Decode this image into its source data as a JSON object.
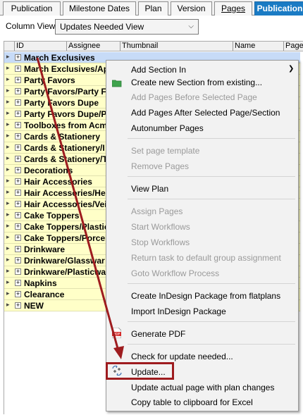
{
  "tabs": [
    {
      "label": "Publication",
      "active": false
    },
    {
      "label": "Milestone Dates",
      "active": false
    },
    {
      "label": "Plan",
      "active": false
    },
    {
      "label": "Version",
      "active": false
    },
    {
      "label": "Pages",
      "active": false
    },
    {
      "label": "Publication",
      "active": true
    }
  ],
  "column_view": {
    "label": "Column View:",
    "selected": "Updates Needed View"
  },
  "grid": {
    "columns": [
      "ID",
      "Assignee",
      "Thumbnail",
      "Name",
      "Page"
    ],
    "rows": [
      "March Exclusives",
      "March Exclusives/Apr",
      "Party Favors",
      "Party Favors/Party F",
      "Party Favors Dupe",
      "Party Favors Dupe/Pa",
      "Toolboxes from Acmo",
      "Cards & Stationery",
      "Cards & Stationery/I",
      "Cards & Stationery/T",
      "Decorations",
      "Hair Accessories",
      "Hair Accessories/Hea",
      "Hair Accessories/Veil",
      "Cake Toppers",
      "Cake Toppers/Plastic",
      "Cake Toppers/Porcel",
      "Drinkware",
      "Drinkware/Glasswar",
      "Drinkware/Plasticwa",
      "Napkins",
      "Clearance",
      "NEW"
    ],
    "selected_row": 0
  },
  "context_menu": {
    "items": [
      {
        "label": "Add Section In",
        "disabled": false,
        "submenu": true
      },
      {
        "label": "Create new Section from existing...",
        "disabled": false,
        "icon": "folder-icon"
      },
      {
        "label": "Add Pages Before Selected Page",
        "disabled": true
      },
      {
        "label": "Add Pages After Selected Page/Section",
        "disabled": false
      },
      {
        "label": "Autonumber Pages",
        "disabled": false
      },
      {
        "label": "Set page template",
        "disabled": true
      },
      {
        "label": "Remove Pages",
        "disabled": true
      },
      {
        "label": "View Plan",
        "disabled": false
      },
      {
        "label": "Assign Pages",
        "disabled": true
      },
      {
        "label": "Start Workflows",
        "disabled": true
      },
      {
        "label": "Stop Workflows",
        "disabled": true
      },
      {
        "label": "Return task to default group assignment",
        "disabled": true
      },
      {
        "label": "Goto Workflow Process",
        "disabled": true
      },
      {
        "label": "Create InDesign Package from flatplans",
        "disabled": false
      },
      {
        "label": "Import InDesign Package",
        "disabled": false
      },
      {
        "label": "Generate PDF",
        "disabled": false,
        "icon": "pdf-icon"
      },
      {
        "label": "Check for update needed...",
        "disabled": false
      },
      {
        "label": "Update...",
        "disabled": false,
        "icon": "update-icon",
        "highlighted": true
      },
      {
        "label": "Update actual page with plan changes",
        "disabled": false
      },
      {
        "label": "Copy table to clipboard for Excel",
        "disabled": false
      }
    ]
  },
  "colors": {
    "tab_active": "#1a7bc4",
    "row_bg": "#ffffc8",
    "row_selected": "#c7dbf7",
    "annotation": "#9e1c1f"
  },
  "icons": {
    "pdf_icon_text": "PDF"
  }
}
